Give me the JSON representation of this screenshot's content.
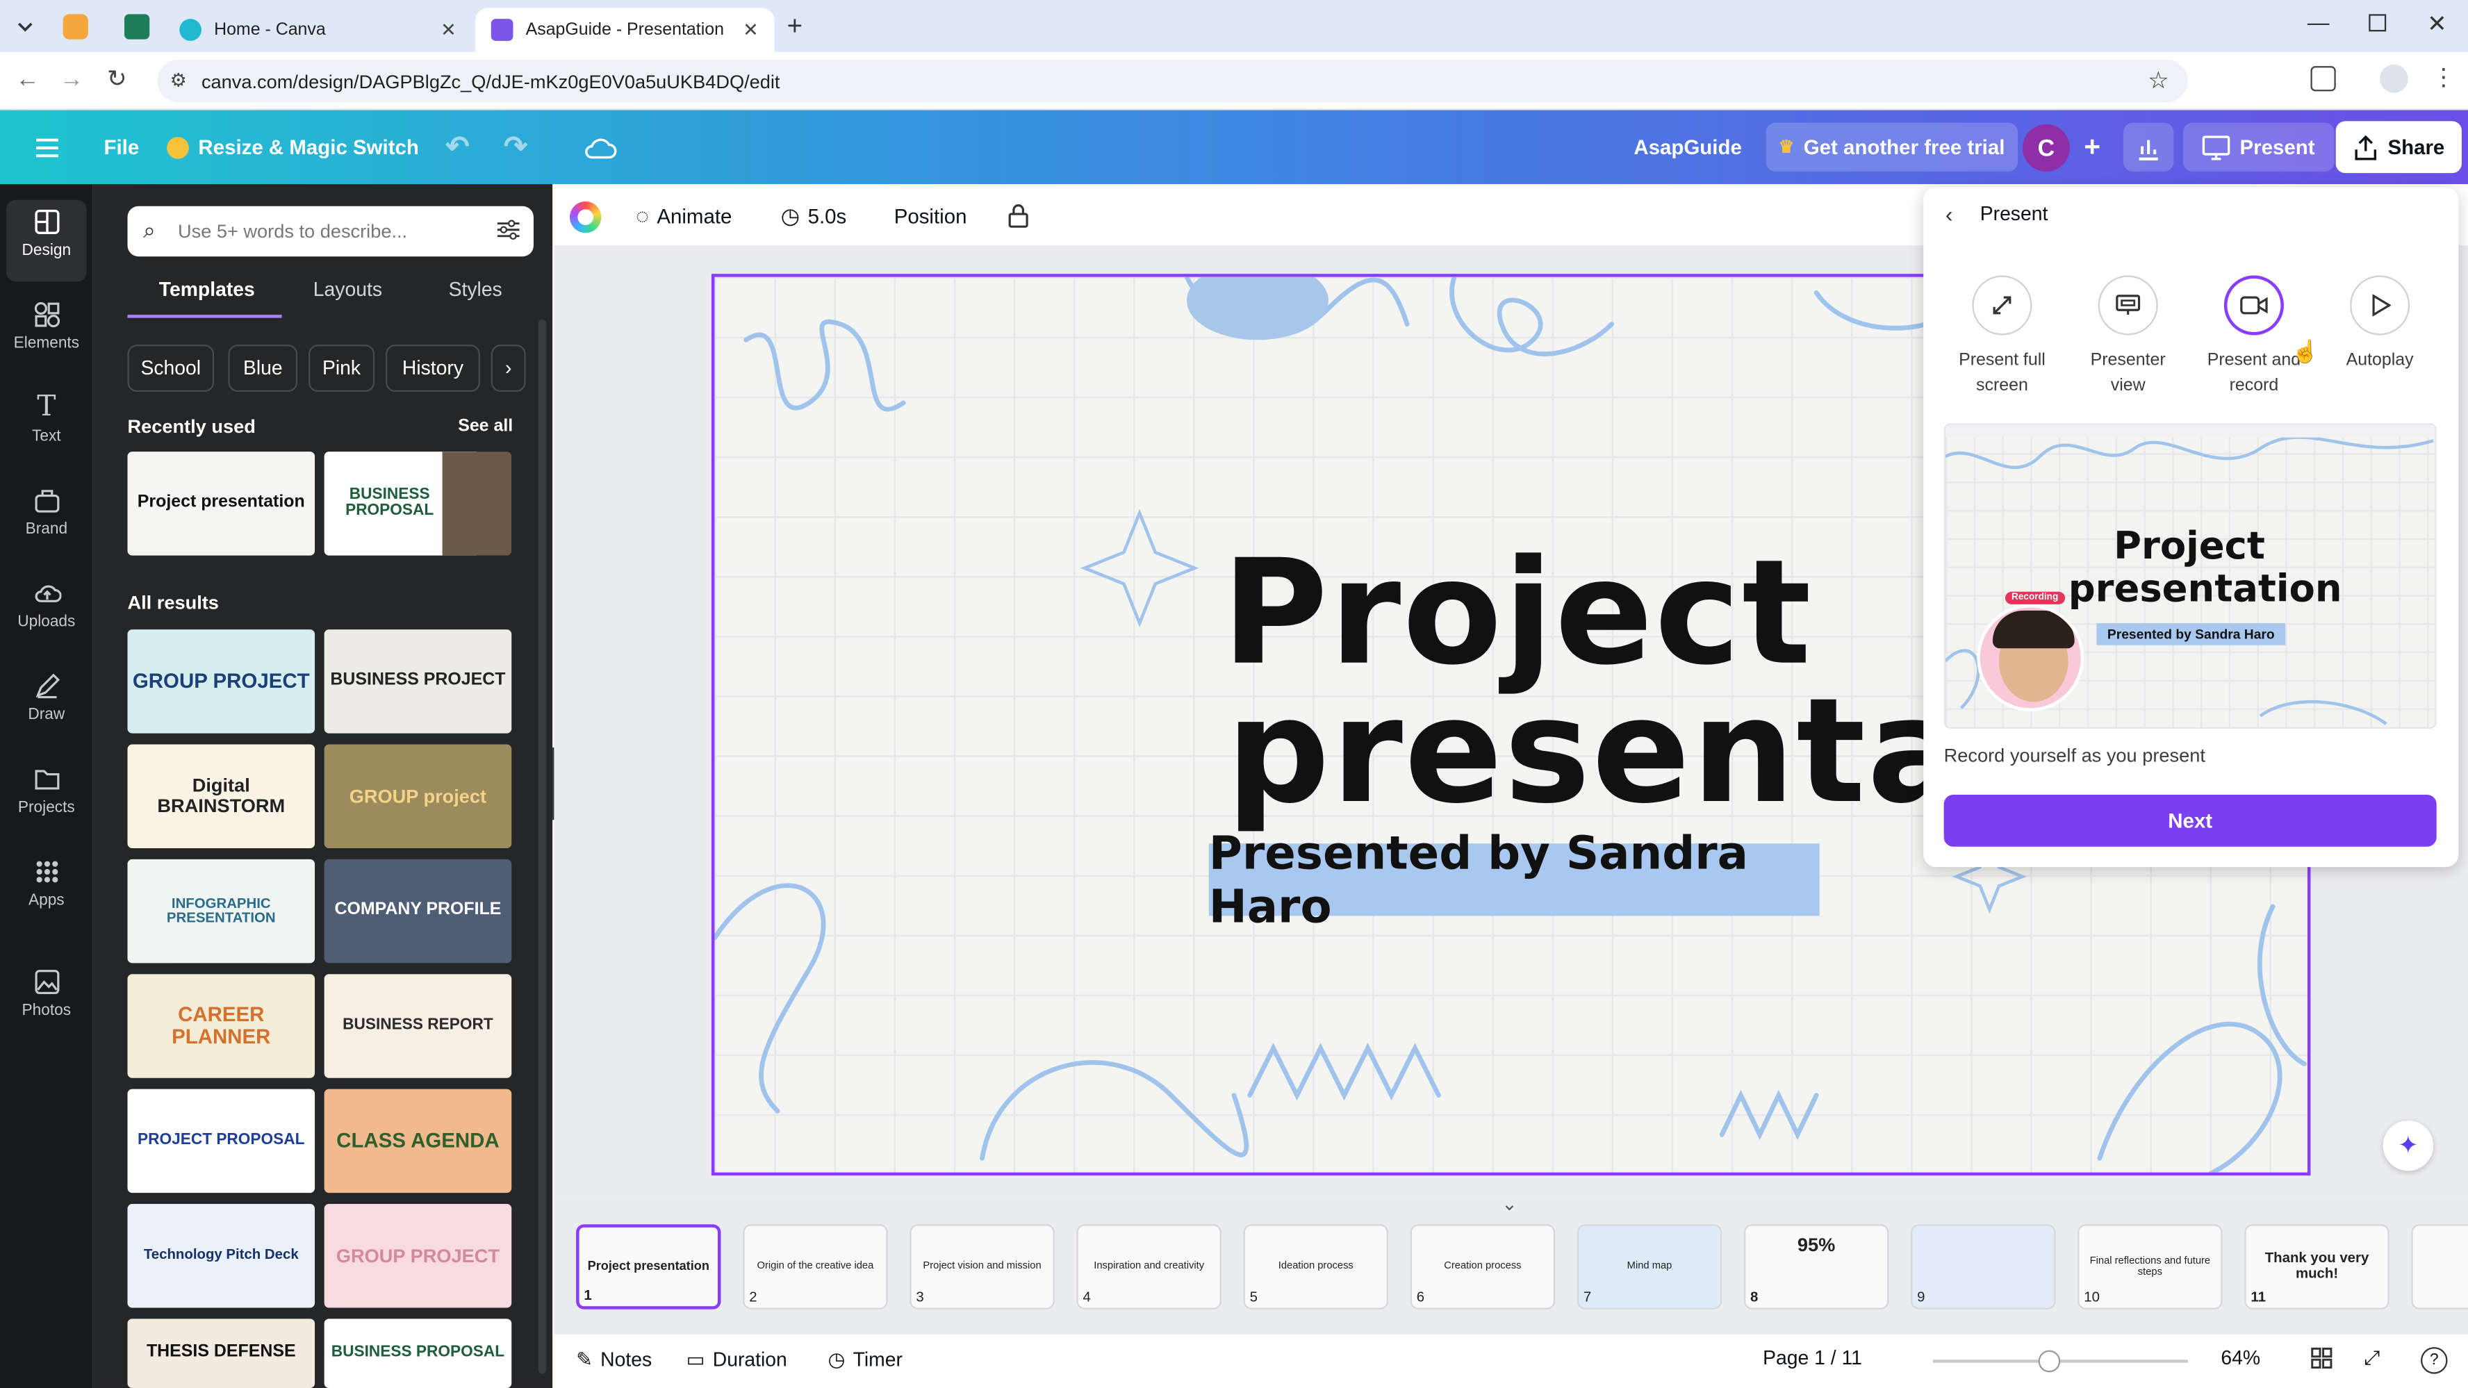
{
  "browser": {
    "tabs": [
      {
        "label": "Home - Canva"
      },
      {
        "label": "AsapGuide - Presentation"
      }
    ],
    "url": "canva.com/design/DAGPBlgZc_Q/dJE-mKz0gE0V0a5uUKB4DQ/edit"
  },
  "header": {
    "file": "File",
    "resize": "Resize & Magic Switch",
    "design_name": "AsapGuide",
    "trial": "Get another free trial",
    "avatar": "C",
    "present": "Present",
    "share": "Share"
  },
  "rail": [
    {
      "label": "Design"
    },
    {
      "label": "Elements"
    },
    {
      "label": "Text"
    },
    {
      "label": "Brand"
    },
    {
      "label": "Uploads"
    },
    {
      "label": "Draw"
    },
    {
      "label": "Projects"
    },
    {
      "label": "Apps"
    },
    {
      "label": "Photos"
    }
  ],
  "panel": {
    "search_placeholder": "Use 5+ words to describe...",
    "tabs": [
      "Templates",
      "Layouts",
      "Styles"
    ],
    "chips": [
      "School",
      "Blue",
      "Pink",
      "History"
    ],
    "recently_used": "Recently used",
    "see_all": "See all",
    "all_results": "All results",
    "recent": [
      "Project presentation",
      "BUSINESS PROPOSAL"
    ],
    "results": [
      "GROUP PROJECT",
      "BUSINESS PROJECT",
      "Digital BRAINSTORM",
      "GROUP project",
      "INFOGRAPHIC PRESENTATION",
      "COMPANY PROFILE",
      "CAREER PLANNER",
      "BUSINESS REPORT",
      "PROJECT PROPOSAL",
      "CLASS AGENDA",
      "Technology Pitch Deck",
      "GROUP PROJECT",
      "THESIS DEFENSE",
      "BUSINESS PROPOSAL"
    ]
  },
  "toolbar": {
    "animate": "Animate",
    "duration": "5.0s",
    "position": "Position"
  },
  "slide": {
    "title_line1": "Project",
    "title_line2": "presentation",
    "subtitle": "Presented by Sandra Haro"
  },
  "present_panel": {
    "title": "Present",
    "options": [
      {
        "line1": "Present full",
        "line2": "screen"
      },
      {
        "line1": "Presenter",
        "line2": "view"
      },
      {
        "line1": "Present and",
        "line2": "record"
      },
      {
        "line1": "Autoplay",
        "line2": ""
      }
    ],
    "preview_title1": "Project",
    "preview_title2": "presentation",
    "preview_sub": "Presented by Sandra Haro",
    "recording_tag": "Recording",
    "caption": "Record yourself as you present",
    "next": "Next"
  },
  "filmstrip": [
    {
      "n": "1",
      "t": "Project presentation"
    },
    {
      "n": "2",
      "t": "Origin of the creative idea"
    },
    {
      "n": "3",
      "t": "Project vision and mission"
    },
    {
      "n": "4",
      "t": "Inspiration and creativity"
    },
    {
      "n": "5",
      "t": "Ideation process"
    },
    {
      "n": "6",
      "t": "Creation process"
    },
    {
      "n": "7",
      "t": "Mind map"
    },
    {
      "n": "8",
      "t": "95%"
    },
    {
      "n": "9",
      "t": ""
    },
    {
      "n": "10",
      "t": "Final reflections and future steps"
    },
    {
      "n": "11",
      "t": "Thank you very much!"
    }
  ],
  "footer": {
    "notes": "Notes",
    "duration": "Duration",
    "timer": "Timer",
    "page": "Page 1 / 11",
    "zoom": "64%"
  },
  "zoom_level": 0.64,
  "colors": {
    "accent": "#8b3dff",
    "next": "#7b3ff2",
    "subtitle_highlight": "#a9c8ef"
  }
}
